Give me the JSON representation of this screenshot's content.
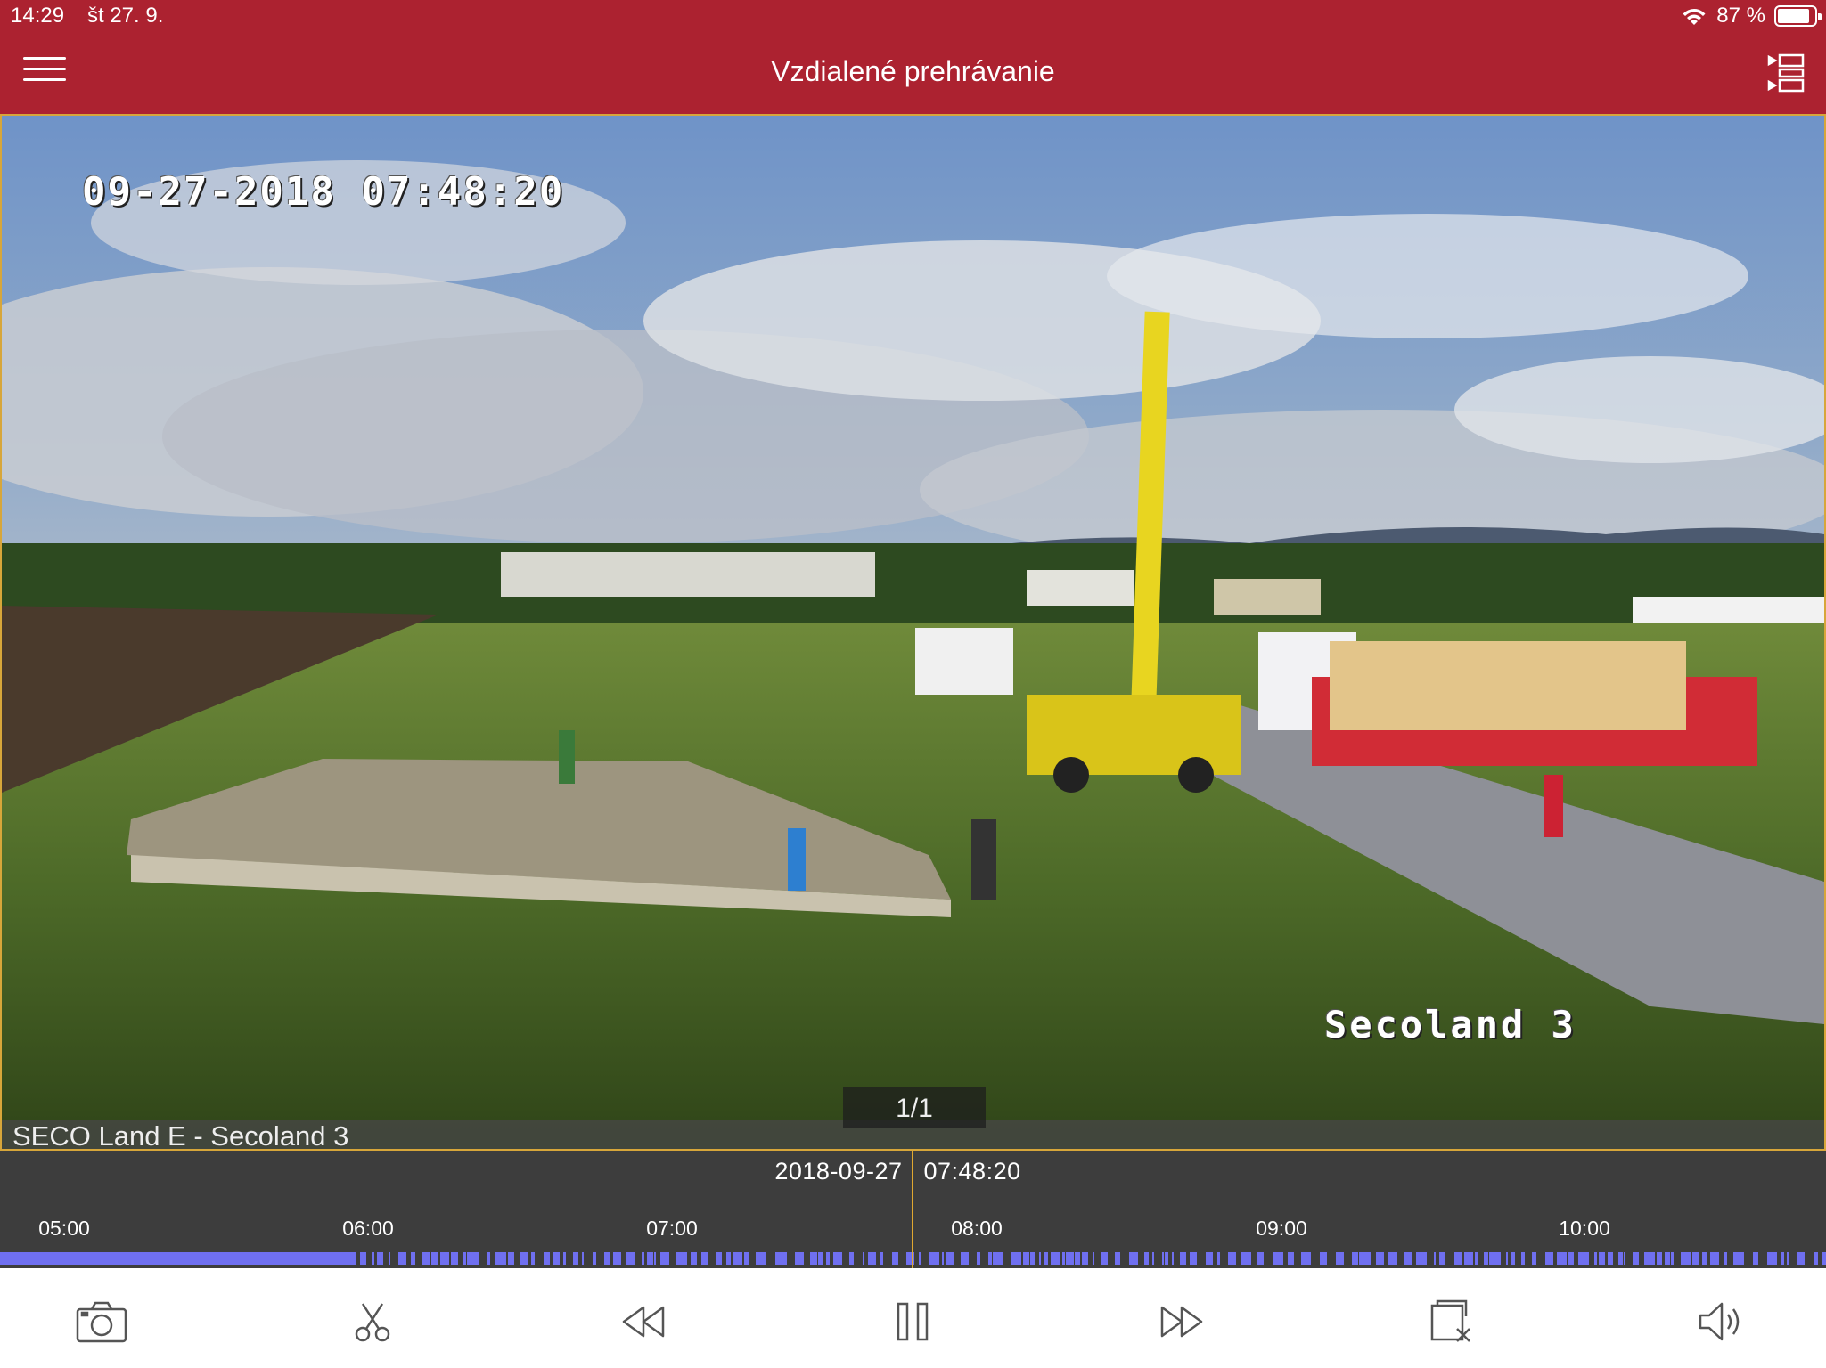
{
  "status_bar": {
    "time": "14:29",
    "date": "št 27. 9.",
    "battery_text": "87 %",
    "battery_level": 0.87
  },
  "nav": {
    "title": "Vzdialené prehrávanie",
    "menu_icon": "hamburger-menu-icon",
    "layout_icon": "channel-list-icon"
  },
  "video": {
    "osd_timestamp": "09-27-2018 07:48:20",
    "osd_camera_label": "Secoland 3",
    "page_indicator": "1/1",
    "camera_name": "SECO Land E - Secoland 3"
  },
  "timeline": {
    "current_date": "2018-09-27",
    "current_time": "07:48:20",
    "ticks": [
      "05:00",
      "06:00",
      "07:00",
      "08:00",
      "09:00",
      "10:00"
    ],
    "cursor_color": "#e0a830",
    "recording_color": "#6f6ff0"
  },
  "toolbar": {
    "buttons": [
      {
        "icon": "camera-icon",
        "action": "snapshot"
      },
      {
        "icon": "scissors-icon",
        "action": "clip"
      },
      {
        "icon": "rewind-icon",
        "action": "slow-down"
      },
      {
        "icon": "pause-icon",
        "action": "pause"
      },
      {
        "icon": "fast-forward-icon",
        "action": "speed-up"
      },
      {
        "icon": "close-window-icon",
        "action": "stop"
      },
      {
        "icon": "speaker-icon",
        "action": "audio"
      }
    ]
  },
  "colors": {
    "header": "#ac2230",
    "video_border": "#d7a63a",
    "timeline_bg": "#3d3d3d"
  }
}
